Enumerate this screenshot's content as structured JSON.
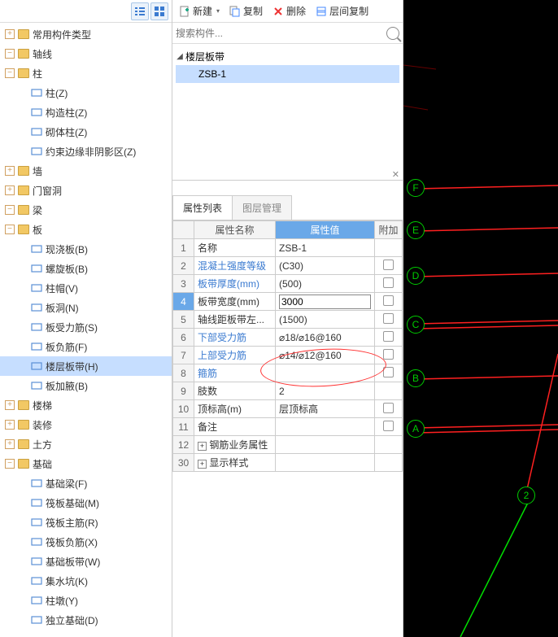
{
  "left_toolbar": {
    "btn1": "list-icon",
    "btn2": "grid-icon"
  },
  "tree": [
    {
      "level": 1,
      "toggle": "plus",
      "folder": true,
      "label": "常用构件类型"
    },
    {
      "level": 1,
      "toggle": "minus",
      "folder": true,
      "label": "轴线"
    },
    {
      "level": 1,
      "toggle": "minus",
      "folder": true,
      "label": "柱"
    },
    {
      "level": 2,
      "icon": "col",
      "label": "柱(Z)"
    },
    {
      "level": 2,
      "icon": "col2",
      "label": "构造柱(Z)"
    },
    {
      "level": 2,
      "icon": "col3",
      "label": "砌体柱(Z)"
    },
    {
      "level": 2,
      "icon": "col4",
      "label": "约束边缘非阴影区(Z)"
    },
    {
      "level": 1,
      "toggle": "plus",
      "folder": true,
      "label": "墙"
    },
    {
      "level": 1,
      "toggle": "plus",
      "folder": true,
      "label": "门窗洞"
    },
    {
      "level": 1,
      "toggle": "minus",
      "folder": true,
      "label": "梁"
    },
    {
      "level": 1,
      "toggle": "minus",
      "folder": true,
      "label": "板"
    },
    {
      "level": 2,
      "icon": "slab",
      "label": "现浇板(B)"
    },
    {
      "level": 2,
      "icon": "spiral",
      "label": "螺旋板(B)"
    },
    {
      "level": 2,
      "icon": "cap",
      "label": "柱帽(V)"
    },
    {
      "level": 2,
      "icon": "hole",
      "label": "板洞(N)"
    },
    {
      "level": 2,
      "icon": "rebar",
      "label": "板受力筋(S)"
    },
    {
      "level": 2,
      "icon": "neg",
      "label": "板负筋(F)"
    },
    {
      "level": 2,
      "icon": "strip",
      "label": "楼层板带(H)",
      "selected": true
    },
    {
      "level": 2,
      "icon": "waist",
      "label": "板加腋(B)"
    },
    {
      "level": 1,
      "toggle": "plus",
      "folder": true,
      "label": "楼梯"
    },
    {
      "level": 1,
      "toggle": "plus",
      "folder": true,
      "label": "装修"
    },
    {
      "level": 1,
      "toggle": "plus",
      "folder": true,
      "label": "土方"
    },
    {
      "level": 1,
      "toggle": "minus",
      "folder": true,
      "label": "基础"
    },
    {
      "level": 2,
      "icon": "fbeam",
      "label": "基础梁(F)"
    },
    {
      "level": 2,
      "icon": "raft",
      "label": "筏板基础(M)"
    },
    {
      "level": 2,
      "icon": "rmain",
      "label": "筏板主筋(R)"
    },
    {
      "level": 2,
      "icon": "rneg",
      "label": "筏板负筋(X)"
    },
    {
      "level": 2,
      "icon": "bstrip",
      "label": "基础板带(W)"
    },
    {
      "level": 2,
      "icon": "sump",
      "label": "集水坑(K)"
    },
    {
      "level": 2,
      "icon": "pier",
      "label": "柱墩(Y)"
    },
    {
      "level": 2,
      "icon": "iso",
      "label": "独立基础(D)"
    }
  ],
  "mid_toolbar": {
    "new": "新建",
    "copy": "复制",
    "delete": "删除",
    "layer_copy": "层间复制"
  },
  "search_placeholder": "搜索构件...",
  "component_tree": {
    "root": "楼层板带",
    "child": "ZSB-1"
  },
  "tabs": {
    "props": "属性列表",
    "layers": "图层管理"
  },
  "prop_headers": {
    "name": "属性名称",
    "value": "属性值",
    "extra": "附加"
  },
  "props": [
    {
      "n": "1",
      "name": "名称",
      "value": "ZSB-1",
      "link": false,
      "chk": false
    },
    {
      "n": "2",
      "name": "混凝土强度等级",
      "value": "(C30)",
      "link": true,
      "chk": true
    },
    {
      "n": "3",
      "name": "板带厚度(mm)",
      "value": "(500)",
      "link": true,
      "chk": true
    },
    {
      "n": "4",
      "name": "板带宽度(mm)",
      "value": "3000",
      "link": false,
      "chk": true,
      "sel": true,
      "editing": true
    },
    {
      "n": "5",
      "name": "轴线距板带左...",
      "value": "(1500)",
      "link": false,
      "chk": true
    },
    {
      "n": "6",
      "name": "下部受力筋",
      "value": "⌀18/⌀16@160",
      "link": true,
      "chk": true
    },
    {
      "n": "7",
      "name": "上部受力筋",
      "value": "⌀14/⌀12@160",
      "link": true,
      "chk": true
    },
    {
      "n": "8",
      "name": "箍筋",
      "value": "",
      "link": true,
      "chk": true
    },
    {
      "n": "9",
      "name": "肢数",
      "value": "2",
      "link": false,
      "chk": false
    },
    {
      "n": "10",
      "name": "顶标高(m)",
      "value": "层顶标高",
      "link": false,
      "chk": true
    },
    {
      "n": "11",
      "name": "备注",
      "value": "",
      "link": false,
      "chk": true
    },
    {
      "n": "12",
      "name": "钢筋业务属性",
      "value": "",
      "exp": true
    },
    {
      "n": "30",
      "name": "显示样式",
      "value": "",
      "exp": true
    }
  ],
  "axis_labels": [
    "F",
    "E",
    "D",
    "C",
    "B",
    "A",
    "2"
  ]
}
